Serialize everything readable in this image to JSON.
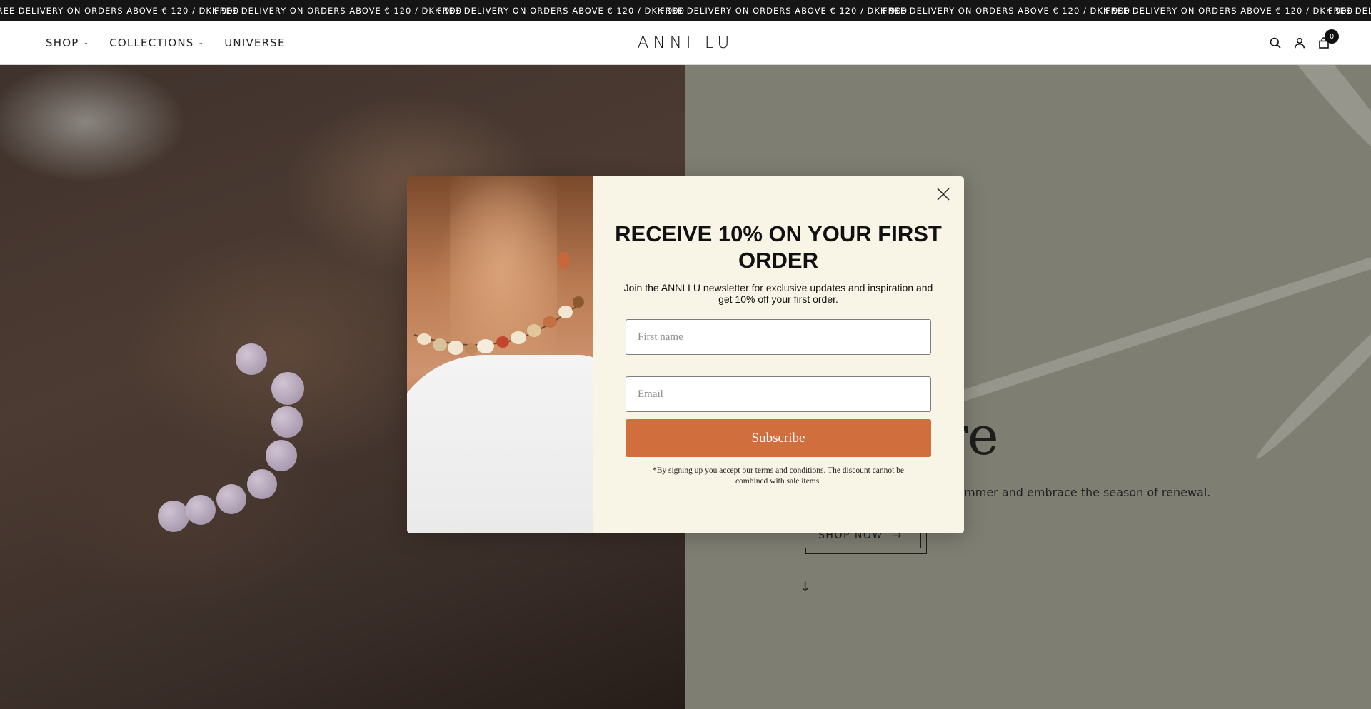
{
  "announcement": {
    "text": "FREE DELIVERY ON ORDERS ABOVE € 120 / DKK 900",
    "repeats": [
      "FREE DELIVERY ON ORDERS ABOVE € 120 / DKK 900",
      "FREE DELIVERY ON ORDERS ABOVE € 120 / DKK 900",
      "FREE DELIVERY ON ORDERS ABOVE € 120 / DKK 900",
      "FREE DELIVERY ON ORDERS ABOVE € 120 / DKK 900",
      "FREE DELIVERY ON ORDERS ABOVE € 120 / DKK 900",
      "FREE DELIVERY ON ORDERS ABOVE € 120 / DKK 900",
      "FREE DELIVERY ON ORDERS ABOVE € 120 / DKK 900"
    ]
  },
  "header": {
    "logo": "ANNI LU",
    "nav": [
      {
        "label": "SHOP",
        "has_dropdown": true
      },
      {
        "label": "COLLECTIONS",
        "has_dropdown": true
      },
      {
        "label": "UNIVERSE",
        "has_dropdown": false
      }
    ],
    "icons": [
      "search-icon",
      "account-icon",
      "cart-icon"
    ],
    "cart_count": "0"
  },
  "hero": {
    "title_visible": "r is here",
    "subtitle_visible": "ummer and embrace the season of renewal.",
    "button_label": "SHOP NOW"
  },
  "modal": {
    "title": "RECEIVE 10% ON YOUR FIRST ORDER",
    "description": "Join the ANNI LU newsletter for exclusive updates and inspiration and get 10% off your first order.",
    "first_name_placeholder": "First name",
    "email_placeholder": "Email",
    "subscribe_label": "Subscribe",
    "disclaimer": "*By signing up you accept our terms and conditions. The discount cannot be combined with sale items."
  },
  "colors": {
    "announcement_bg": "#151515",
    "subscribe_button": "#d06e3e",
    "modal_bg": "#f8f4e6",
    "hero_right_bg": "#7f7e73"
  }
}
